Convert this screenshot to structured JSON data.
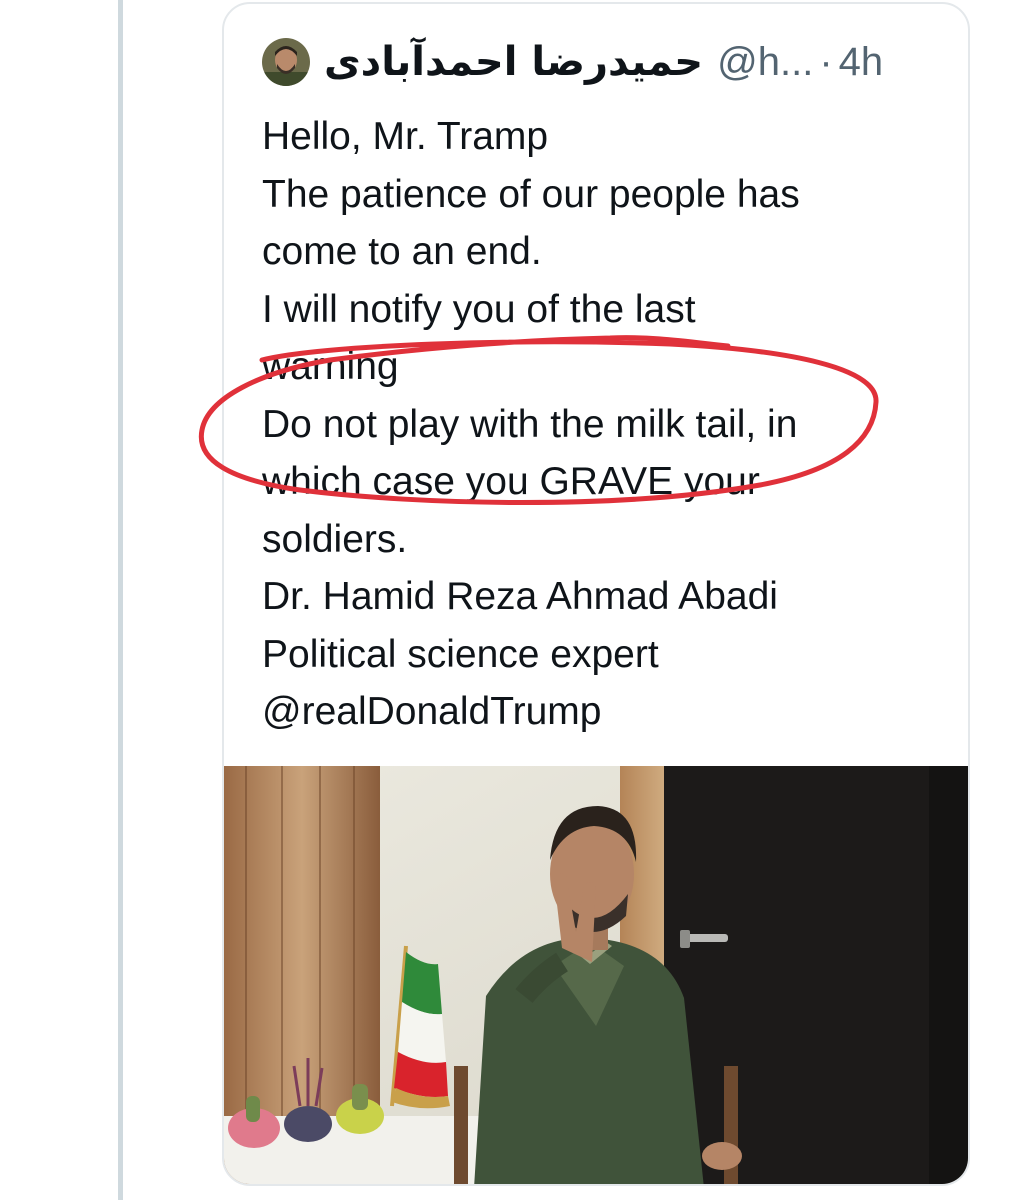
{
  "tweet": {
    "author_name": "حمیدرضا احمدآبادی",
    "handle": "@h...",
    "separator": "·",
    "time": "4h",
    "lines": [
      "Hello, Mr. Tramp",
      "The patience of our people has",
      "come to an end.",
      "I will notify you of the last",
      "warning",
      "Do not play with the milk tail, in",
      "which case you GRAVE your",
      "soldiers.",
      "Dr. Hamid Reza Ahmad Abadi",
      "Political science expert",
      "@realDonaldTrump"
    ]
  },
  "annotation": {
    "color": "#e0313a"
  },
  "icons": {
    "avatar": "avatar-photo",
    "photo": "man-with-iran-flag-photo"
  }
}
